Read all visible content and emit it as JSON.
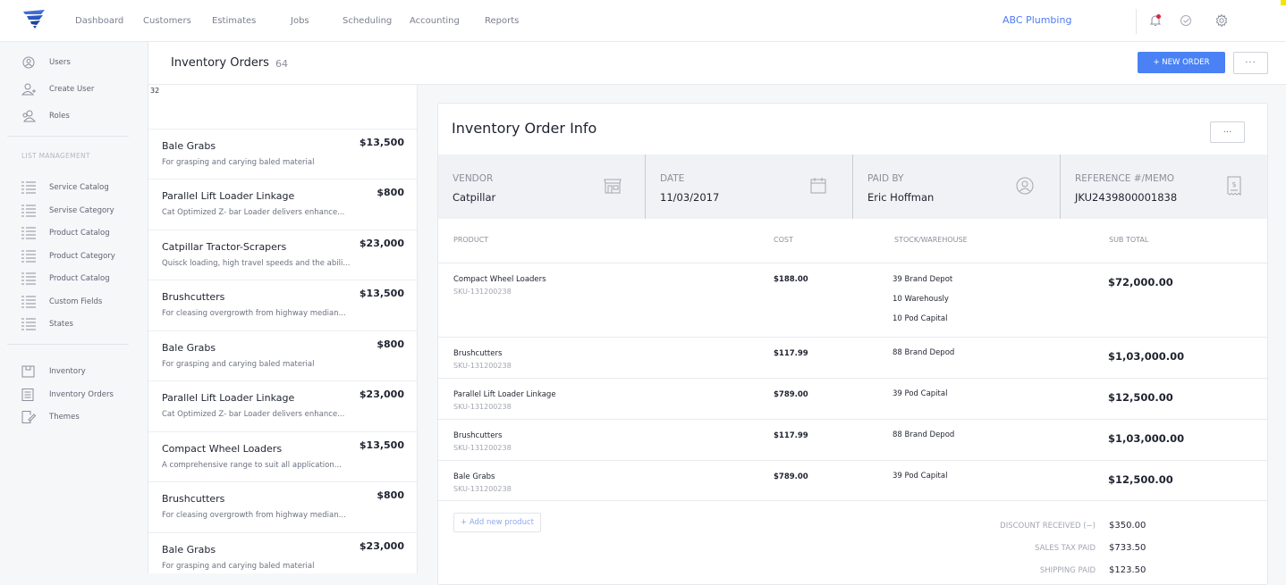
{
  "topbar": {
    "nav": [
      "Dashboard",
      "Customers",
      "Estimates",
      "Jobs",
      "Scheduling",
      "Accounting",
      "Reports"
    ],
    "company": "ABC Plumbing",
    "icons": [
      "bell-icon",
      "check-circle-icon",
      "gear-icon"
    ]
  },
  "sidebar": {
    "top_items": [
      {
        "label": "Users",
        "icon": "user-icon"
      },
      {
        "label": "Create User",
        "icon": "user-add-icon"
      },
      {
        "label": "Roles",
        "icon": "users-icon"
      }
    ],
    "list_header": "LIST MANAGEMENT",
    "list_items": [
      {
        "label": "Service Catalog",
        "icon": "list-icon"
      },
      {
        "label": "Servise Category",
        "icon": "list-icon"
      },
      {
        "label": "Product Catalog",
        "icon": "list-icon"
      },
      {
        "label": "Product Category",
        "icon": "list-icon"
      },
      {
        "label": "Product Catalog",
        "icon": "list-icon"
      },
      {
        "label": "Custom Fields",
        "icon": "list-icon"
      },
      {
        "label": "States",
        "icon": "list-icon"
      }
    ],
    "bottom_items": [
      {
        "label": "Inventory",
        "icon": "box-icon"
      },
      {
        "label": "Inventory Orders",
        "icon": "document-icon"
      },
      {
        "label": "Themes",
        "icon": "theme-icon"
      }
    ]
  },
  "header": {
    "title": "Inventory Orders",
    "count": "64",
    "new_order": "+ NEW ORDER",
    "more": "···"
  },
  "list": {
    "number": "32",
    "items": [
      {
        "name": "Bale Grabs",
        "price": "$13,500",
        "desc": "For grasping and carying baled material"
      },
      {
        "name": "Parallel Lift Loader Linkage",
        "price": "$800",
        "desc": "Cat Optimized Z- bar Loader delivers enhance..."
      },
      {
        "name": "Catpillar Tractor-Scrapers",
        "price": "$23,000",
        "desc": "Quisck loading, high travel speeds and the abili..."
      },
      {
        "name": "Brushcutters",
        "price": "$13,500",
        "desc": "For cleasing overgrowth from highway median..."
      },
      {
        "name": "Bale Grabs",
        "price": "$800",
        "desc": "For grasping and carying baled material"
      },
      {
        "name": "Parallel Lift Loader Linkage",
        "price": "$23,000",
        "desc": "Cat Optimized Z- bar Loader delivers enhance..."
      },
      {
        "name": "Compact Wheel Loaders",
        "price": "$13,500",
        "desc": "A comprehensive range to suit all application..."
      },
      {
        "name": "Brushcutters",
        "price": "$800",
        "desc": "For cleasing overgrowth from highway median..."
      },
      {
        "name": "Bale Grabs",
        "price": "$23,000",
        "desc": "For grasping and carying baled material"
      }
    ]
  },
  "detail": {
    "title": "Inventory Order Info",
    "more": "···",
    "info": [
      {
        "label": "VENDOR",
        "value": "Catpillar",
        "icon": "store-icon"
      },
      {
        "label": "DATE",
        "value": "11/03/2017",
        "icon": "calendar-icon"
      },
      {
        "label": "PAID BY",
        "value": "Eric Hoffman",
        "icon": "user-circle-icon"
      },
      {
        "label": "REFERENCE #/MEMO",
        "value": "JKU2439800001838",
        "icon": "receipt-icon"
      }
    ],
    "columns": [
      "PRODUCT",
      "COST",
      "STOCK/WAREHOUSE",
      "SUB TOTAL"
    ],
    "rows": [
      {
        "product": "Compact Wheel Loaders",
        "sku": "SKU-131200238",
        "cost": "$188.00",
        "stock": [
          "39 Brand Depot",
          "10 Warehously",
          "10 Pod Capital"
        ],
        "subtotal": "$72,000.00"
      },
      {
        "product": "Brushcutters",
        "sku": "SKU-131200238",
        "cost": "$117.99",
        "stock": [
          "88 Brand Depod"
        ],
        "subtotal": "$1,03,000.00"
      },
      {
        "product": "Parallel Lift Loader Linkage",
        "sku": "SKU-131200238",
        "cost": "$789.00",
        "stock": [
          "39 Pod Capital"
        ],
        "subtotal": "$12,500.00"
      },
      {
        "product": "Brushcutters",
        "sku": "SKU-131200238",
        "cost": "$117.99",
        "stock": [
          "88 Brand Depod"
        ],
        "subtotal": "$1,03,000.00"
      },
      {
        "product": "Bale Grabs",
        "sku": "SKU-131200238",
        "cost": "$789.00",
        "stock": [
          "39 Pod Capital"
        ],
        "subtotal": "$12,500.00"
      }
    ],
    "add_product": "+ Add new product",
    "summary": [
      {
        "label": "DISCOUNT RECEIVED (−)",
        "value": "$350.00"
      },
      {
        "label": "SALES TAX PAID",
        "value": "$733.50"
      },
      {
        "label": "SHIPPING PAID",
        "value": "$123.50"
      }
    ]
  }
}
